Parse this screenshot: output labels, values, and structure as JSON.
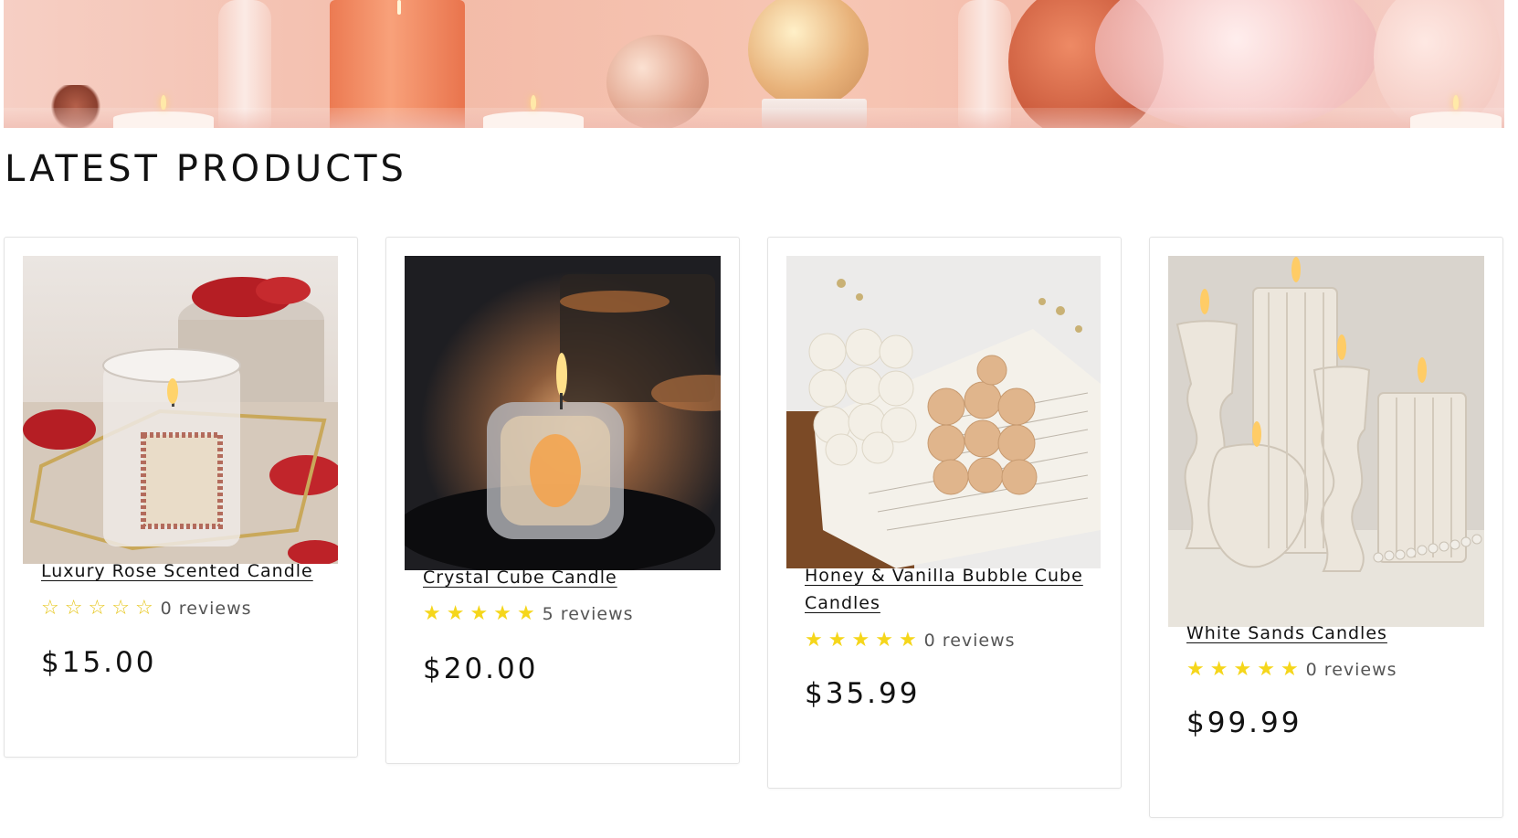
{
  "section": {
    "title": "LATEST PRODUCTS"
  },
  "colors": {
    "star": "#f5d61b",
    "text": "#121212",
    "border": "#e3e3e3"
  },
  "products": [
    {
      "title_lines": [
        "Luxury Rose Scented Candle"
      ],
      "rating": 0,
      "reviews": "0 reviews",
      "price": "$15.00",
      "image": "rose-candle-jar-image"
    },
    {
      "title_lines": [
        "Crystal Cube Candle"
      ],
      "rating": 5,
      "reviews": "5 reviews",
      "price": "$20.00",
      "image": "crystal-cube-candle-image"
    },
    {
      "title_lines": [
        "Honey & Vanilla Bubble Cube",
        "Candles"
      ],
      "rating": 5,
      "reviews": "0 reviews",
      "price": "$35.99",
      "image": "bubble-cube-candles-image"
    },
    {
      "title_lines": [
        "White Sands Candles"
      ],
      "rating": 5,
      "reviews": "0 reviews",
      "price": "$99.99",
      "image": "white-pillar-candles-image"
    }
  ]
}
